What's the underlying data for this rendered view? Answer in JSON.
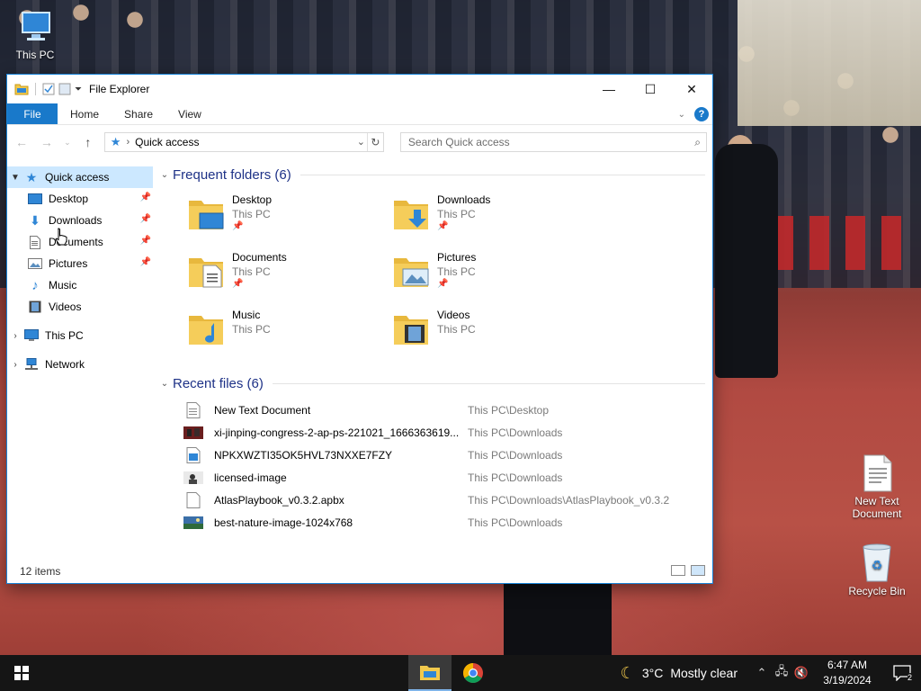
{
  "desktop": {
    "icons": [
      {
        "label": "This PC"
      },
      {
        "label": "New Text Document"
      },
      {
        "label": "Recycle Bin"
      }
    ]
  },
  "window": {
    "title": "File Explorer",
    "ribbon_tabs": [
      "File",
      "Home",
      "Share",
      "View"
    ],
    "address": {
      "path": "Quick access"
    },
    "search": {
      "placeholder": "Search Quick access"
    },
    "nav": {
      "quick_access": "Quick access",
      "pinned": [
        {
          "label": "Desktop",
          "pinned": true
        },
        {
          "label": "Downloads",
          "pinned": true
        },
        {
          "label": "Documents",
          "pinned": true
        },
        {
          "label": "Pictures",
          "pinned": true
        },
        {
          "label": "Music",
          "pinned": false
        },
        {
          "label": "Videos",
          "pinned": false
        }
      ],
      "this_pc": "This PC",
      "network": "Network"
    },
    "frequent": {
      "heading": "Frequent folders (6)",
      "folders": [
        {
          "name": "Desktop",
          "location": "This PC",
          "pinned": true,
          "icon": "desktop-overlay"
        },
        {
          "name": "Downloads",
          "location": "This PC",
          "pinned": true,
          "icon": "download-overlay"
        },
        {
          "name": "Documents",
          "location": "This PC",
          "pinned": true,
          "icon": "document-overlay"
        },
        {
          "name": "Pictures",
          "location": "This PC",
          "pinned": true,
          "icon": "picture-overlay"
        },
        {
          "name": "Music",
          "location": "This PC",
          "pinned": false,
          "icon": "music-overlay"
        },
        {
          "name": "Videos",
          "location": "This PC",
          "pinned": false,
          "icon": "video-overlay"
        }
      ]
    },
    "recent": {
      "heading": "Recent files (6)",
      "files": [
        {
          "name": "New Text Document",
          "location": "This PC\\Desktop",
          "icon": "text-file"
        },
        {
          "name": "xi-jinping-congress-2-ap-ps-221021_1666363619...",
          "location": "This PC\\Downloads",
          "icon": "photo-thumb"
        },
        {
          "name": "NPKXWZTI35OK5HVL73NXXE7FZY",
          "location": "This PC\\Downloads",
          "icon": "image-file"
        },
        {
          "name": "licensed-image",
          "location": "This PC\\Downloads",
          "icon": "photo-thumb"
        },
        {
          "name": "AtlasPlaybook_v0.3.2.apbx",
          "location": "This PC\\Downloads\\AtlasPlaybook_v0.3.2",
          "icon": "blank-file"
        },
        {
          "name": "best-nature-image-1024x768",
          "location": "This PC\\Downloads",
          "icon": "photo-thumb"
        }
      ]
    },
    "status": {
      "items": "12 items"
    }
  },
  "taskbar": {
    "weather": {
      "temp": "3°C",
      "condition": "Mostly clear"
    },
    "clock": {
      "time": "6:47 AM",
      "date": "3/19/2024"
    },
    "notifications": "2"
  }
}
